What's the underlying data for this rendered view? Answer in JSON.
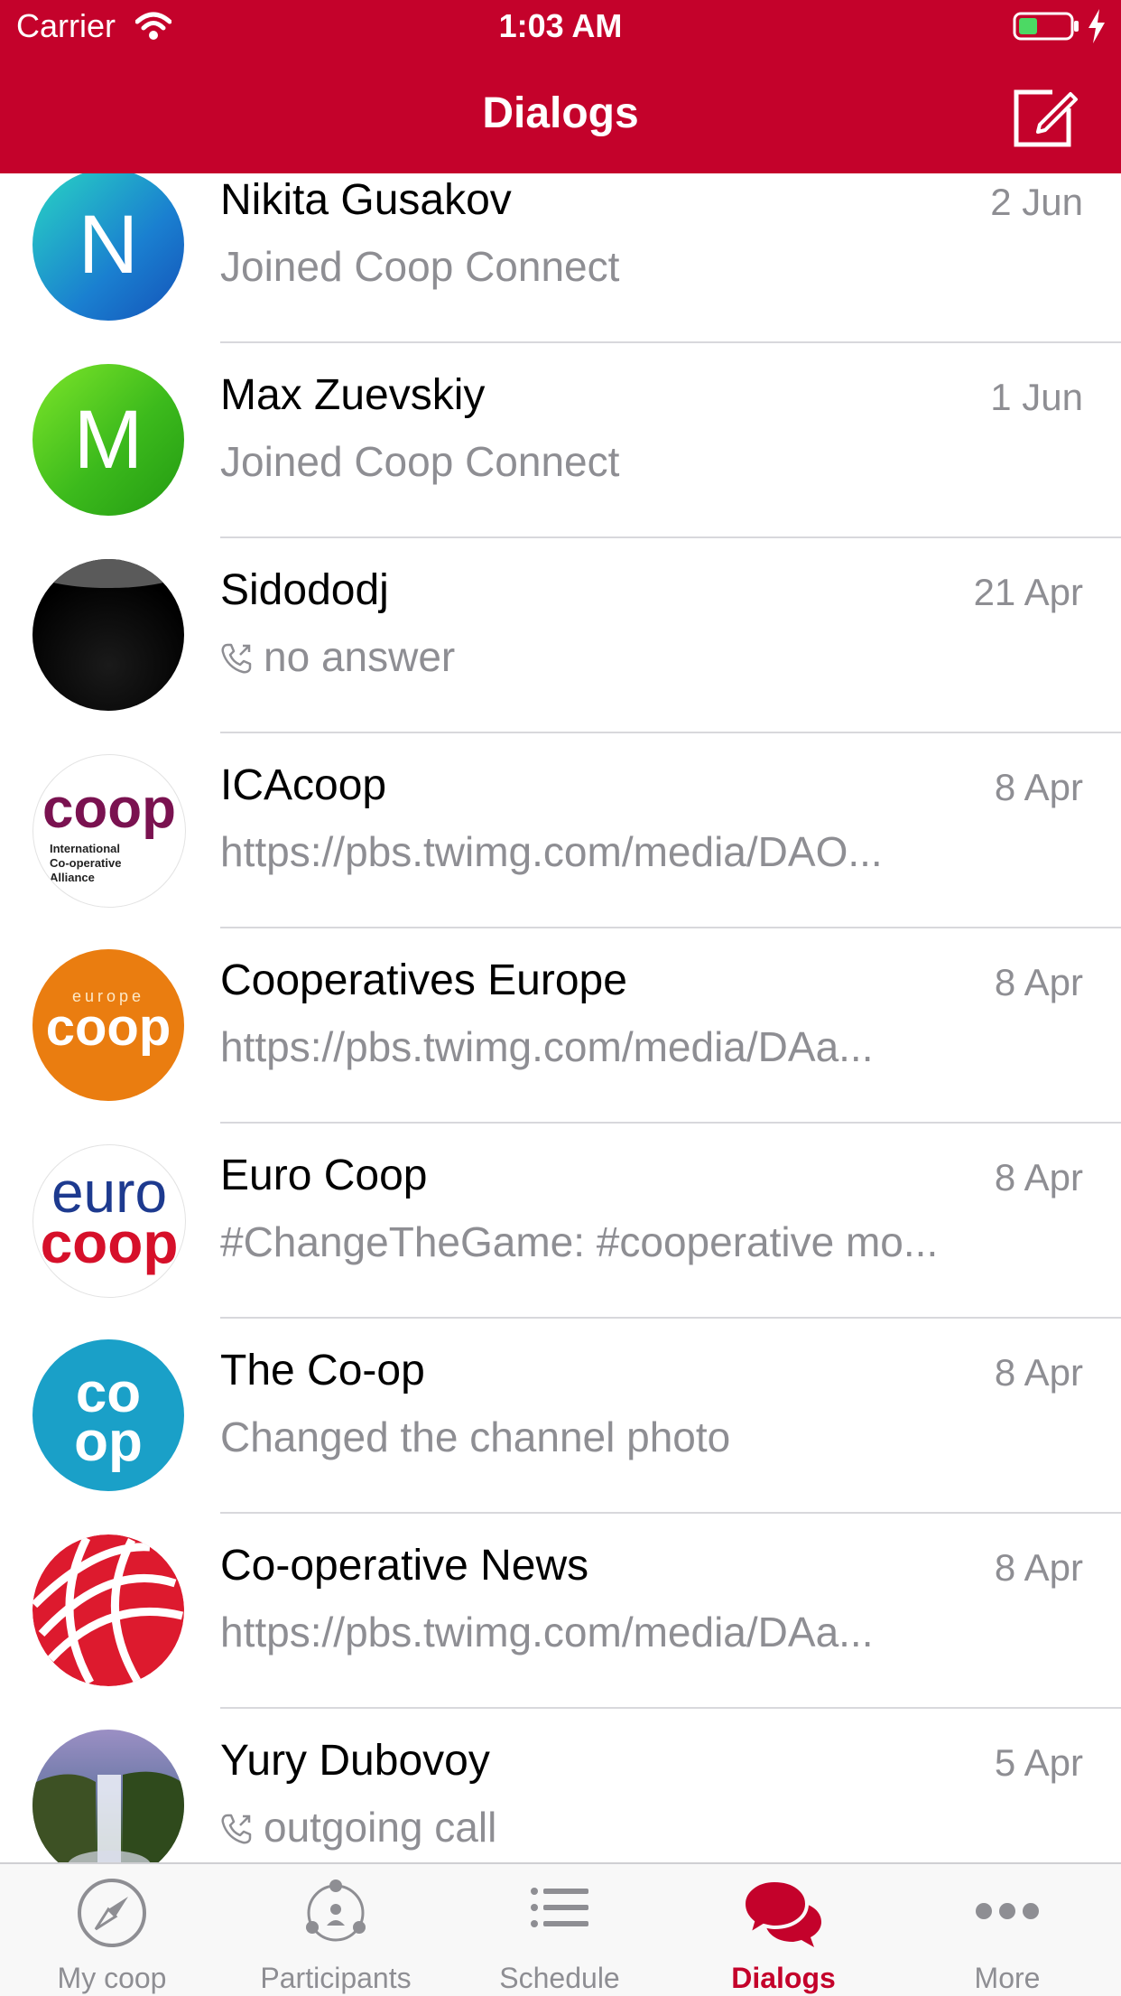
{
  "status_bar": {
    "carrier": "Carrier",
    "time": "1:03 AM",
    "icons": [
      "wifi-icon",
      "battery-icon",
      "charging-bolt-icon"
    ]
  },
  "header": {
    "title": "Dialogs",
    "compose_icon": "compose-icon"
  },
  "colors": {
    "brand_red": "#c4022b",
    "secondary_text": "#8e8e93",
    "divider": "#d8d8dc"
  },
  "dialogs": [
    {
      "name": "Nikita Gusakov",
      "date": "2 Jun",
      "preview": "Joined Coop Connect",
      "avatar_letter": "N",
      "call": false
    },
    {
      "name": "Max Zuevskiy",
      "date": "1 Jun",
      "preview": "Joined Coop Connect",
      "avatar_letter": "M",
      "call": false
    },
    {
      "name": "Sidododj",
      "date": "21 Apr",
      "preview": "no answer",
      "avatar_letter": "",
      "call": true
    },
    {
      "name": "ICAcoop",
      "date": "8 Apr",
      "preview": "https://pbs.twimg.com/media/DAO...",
      "avatar_letter": "",
      "avatar_text": [
        "coop",
        "International",
        "Co-operative",
        "Alliance"
      ],
      "call": false
    },
    {
      "name": "Cooperatives Europe",
      "date": "8 Apr",
      "preview": "https://pbs.twimg.com/media/DAa...",
      "avatar_letter": "",
      "avatar_text": [
        "europe",
        "coop"
      ],
      "call": false
    },
    {
      "name": "Euro Coop",
      "date": "8 Apr",
      "preview": "#ChangeTheGame: #cooperative mo...",
      "avatar_letter": "",
      "avatar_text": [
        "euro",
        "coop"
      ],
      "call": false
    },
    {
      "name": "The Co-op",
      "date": "8 Apr",
      "preview": "Changed the channel photo",
      "avatar_letter": "",
      "avatar_text": [
        "co",
        "op"
      ],
      "call": false
    },
    {
      "name": "Co-operative News",
      "date": "8 Apr",
      "preview": "https://pbs.twimg.com/media/DAa...",
      "avatar_letter": "",
      "call": false
    },
    {
      "name": "Yury Dubovoy",
      "date": "5 Apr",
      "preview": "outgoing call",
      "avatar_letter": "",
      "call": true
    }
  ],
  "tabbar": {
    "tabs": [
      {
        "label": "My coop",
        "icon": "compass-icon",
        "active": false
      },
      {
        "label": "Participants",
        "icon": "participants-icon",
        "active": false
      },
      {
        "label": "Schedule",
        "icon": "list-icon",
        "active": false
      },
      {
        "label": "Dialogs",
        "icon": "chat-bubbles-icon",
        "active": true
      },
      {
        "label": "More",
        "icon": "more-dots-icon",
        "active": false
      }
    ]
  }
}
